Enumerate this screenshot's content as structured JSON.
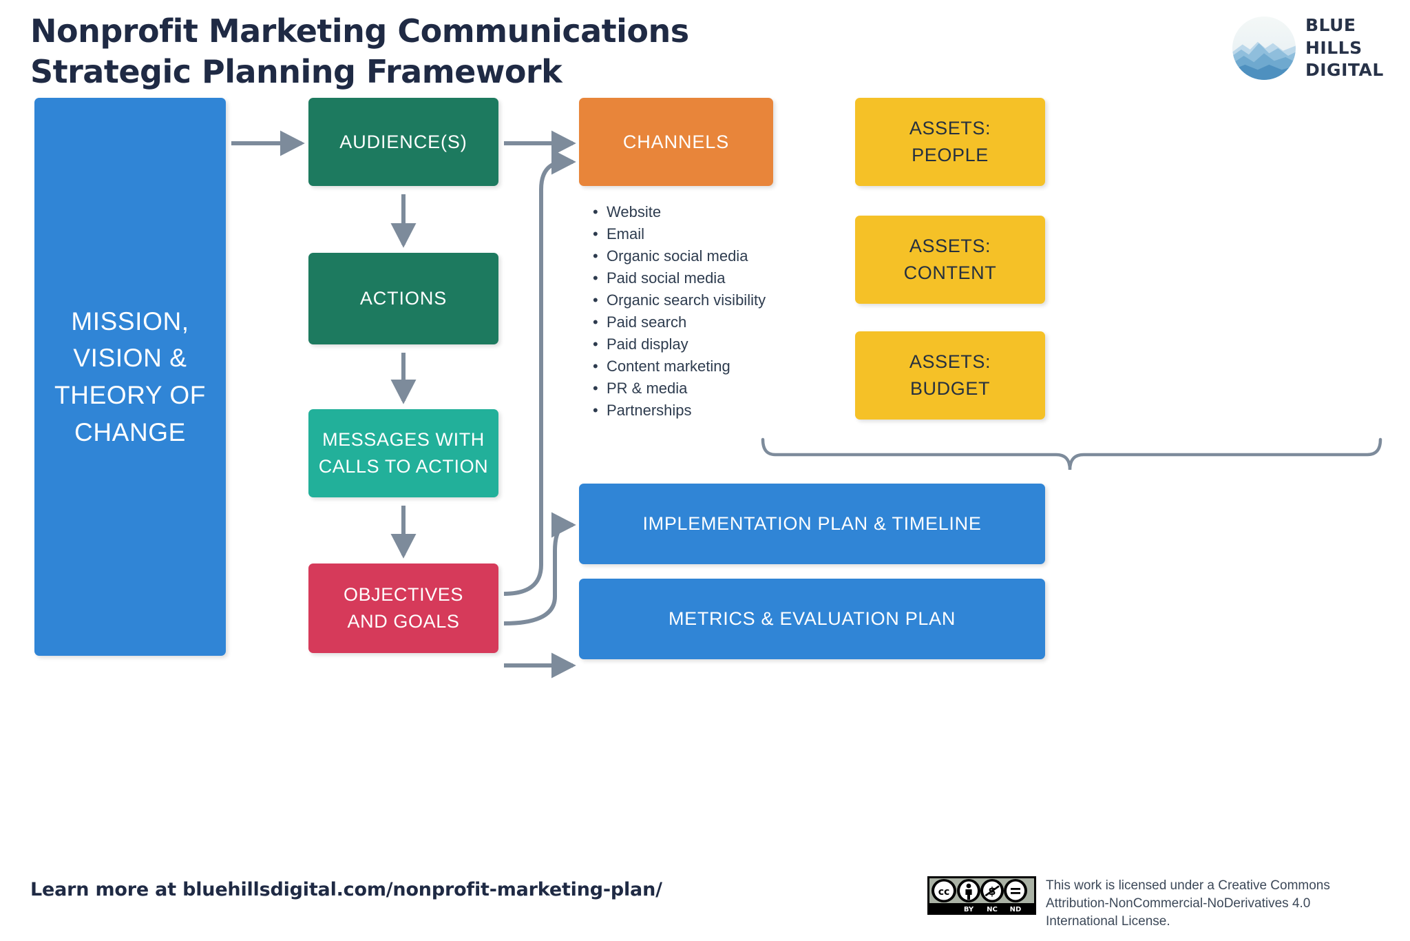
{
  "title": "Nonprofit Marketing Communications\nStrategic Planning Framework",
  "logo": {
    "mark_name": "blue-hills-mountain-logo",
    "text": "BLUE\nHILLS\nDIGITAL"
  },
  "colors": {
    "blue": "#3085d6",
    "dark_green": "#1d7a5f",
    "teal": "#22b09a",
    "red": "#d63a5a",
    "orange": "#e8853a",
    "yellow": "#f5c127",
    "navy_text": "#1f2a44",
    "connector_gray": "#7d8b9b"
  },
  "boxes": {
    "mission": "MISSION,\nVISION &\nTHEORY OF\nCHANGE",
    "audiences": "AUDIENCE(S)",
    "actions": "ACTIONS",
    "messages": "MESSAGES WITH\nCALLS TO ACTION",
    "objectives": "OBJECTIVES\nAND GOALS",
    "channels": "CHANNELS",
    "implementation": "IMPLEMENTATION PLAN & TIMELINE",
    "metrics": "METRICS & EVALUATION PLAN"
  },
  "assets": [
    "ASSETS:\nPEOPLE",
    "ASSETS:\nCONTENT",
    "ASSETS:\nBUDGET"
  ],
  "channel_items": [
    "Website",
    "Email",
    "Organic social media",
    "Paid social media",
    "Organic search visibility",
    "Paid search",
    "Paid display",
    "Content marketing",
    "PR & media",
    "Partnerships"
  ],
  "footer": {
    "learn_more": "Learn more at bluehillsdigital.com/nonprofit-marketing-plan/",
    "license_text": "This work is licensed under a Creative Commons\nAttribution-NonCommercial-NoDerivatives 4.0\nInternational License.",
    "license_badge_labels": [
      "CC",
      "BY",
      "NC",
      "ND"
    ]
  }
}
